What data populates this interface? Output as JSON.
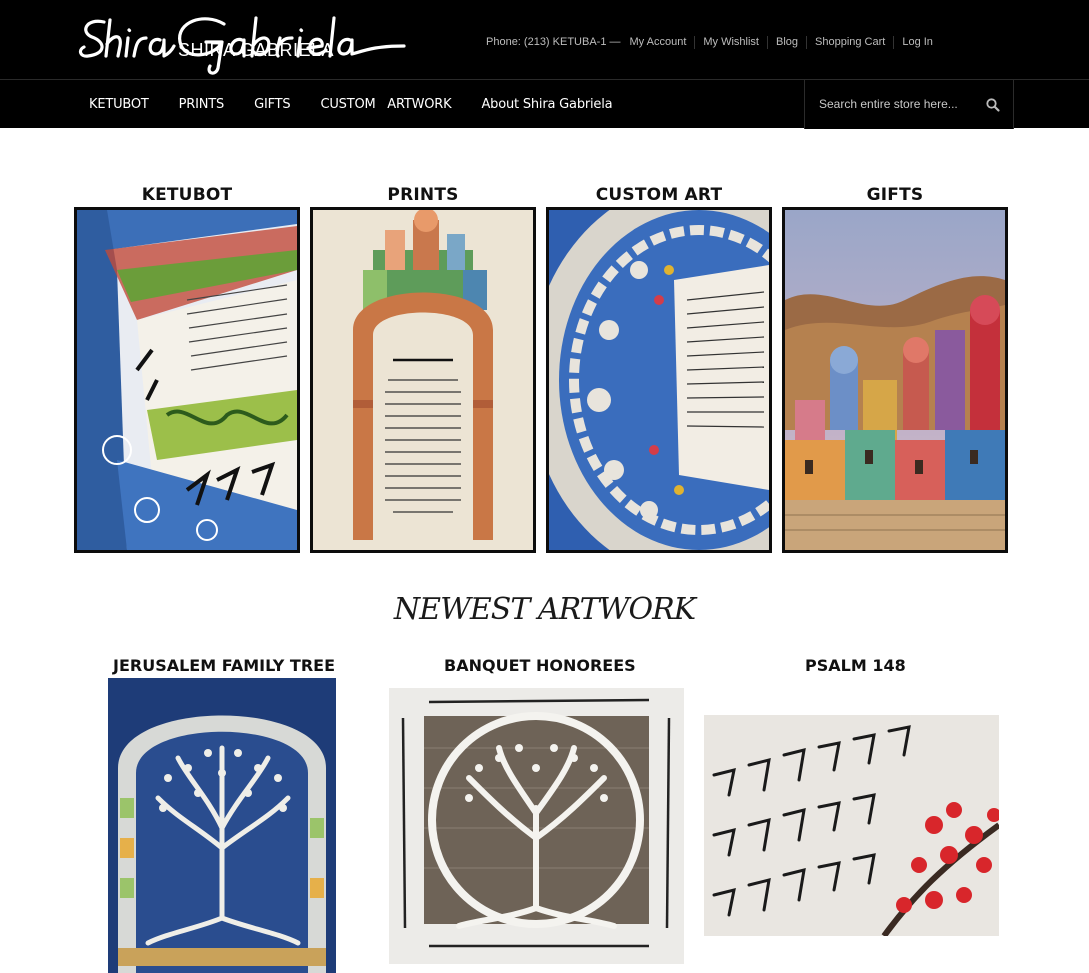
{
  "brand": {
    "script_name": "Shira Gabriela",
    "name": "SHIRA GABRIELA"
  },
  "header": {
    "phone": "Phone: (213) KETUBA-1 —",
    "links": [
      "My Account",
      "My Wishlist",
      "Blog",
      "Shopping Cart",
      "Log In"
    ]
  },
  "nav": {
    "items": [
      "KETUBOT",
      "PRINTS",
      "GIFTS",
      "CUSTOM   ARTWORK",
      "About Shira Gabriela"
    ]
  },
  "search": {
    "placeholder": "Search entire store here...",
    "icon": "search-icon"
  },
  "categories": [
    {
      "title": "KETUBOT"
    },
    {
      "title": "PRINTS"
    },
    {
      "title": "CUSTOM ART"
    },
    {
      "title": "GIFTS"
    }
  ],
  "newest": {
    "title": "NEWEST ARTWORK",
    "items": [
      {
        "title": "JERUSALEM FAMILY TREE"
      },
      {
        "title": "BANQUET HONOREES"
      },
      {
        "title": "PSALM 148"
      }
    ]
  },
  "colors": {
    "header_bg": "#000000",
    "header_text": "#ffffff",
    "link_text": "#bdbdbd",
    "page_bg": "#ffffff"
  }
}
